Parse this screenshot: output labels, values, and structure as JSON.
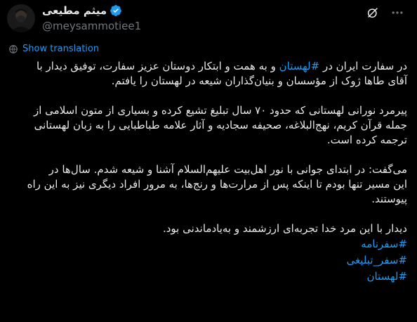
{
  "author": {
    "display_name": "میثم مطیعی",
    "handle": "@meysammotiee1"
  },
  "colors": {
    "background": "#000000",
    "text": "#e7e9ea",
    "muted": "#71767b",
    "accent": "#1d9bf0"
  },
  "icons": {
    "verified": "verified-badge-icon",
    "grok": "grok-icon",
    "more": "more-options-icon",
    "translate": "translate-globe-icon"
  },
  "translate_label": "Show translation",
  "body": {
    "p1": {
      "l1_pre": "در سفارت ایران در ",
      "l1_tag": "#لهستان",
      "l1_post": " و به همت و ابتکار دوستان عزیز سفارت، توفیق دیدار با",
      "l2": "آقای طاها ژوک از مؤسسان و بنیان‌گذاران شیعه در لهستان را یافتم."
    },
    "p2": {
      "l1": "پیرمرد نورانی لهستانی که حدود ۷۰ سال تبلیغ تشیع کرده و بسیاری از متون اسلامی از",
      "l2": "جمله قرآن کریم، نهج‌البلاغه، صحیفه سجادیه و آثار علامه طباطبایی را به زبان لهستانی",
      "l3": "ترجمه کرده است."
    },
    "p3": {
      "l1": "می‌گفت: در ابتدای جوانی با نور اهل‌بیت علیهم‌السلام آشنا و شیعه شدم. سال‌ها در",
      "l2": "این مسیر تنها بودم تا اینکه پس از مرارت‌ها و رنج‌ها، به مرور افراد دیگری نیز به این راه",
      "l3": "پیوستند."
    },
    "p4": {
      "l1": "دیدار با این مرد خدا تجربه‌ای ارزشمند و به‌یادماندنی بود."
    },
    "hashtags": [
      "#سفرنامه",
      "#سفر_تبلیغی",
      "#لهستان"
    ]
  }
}
